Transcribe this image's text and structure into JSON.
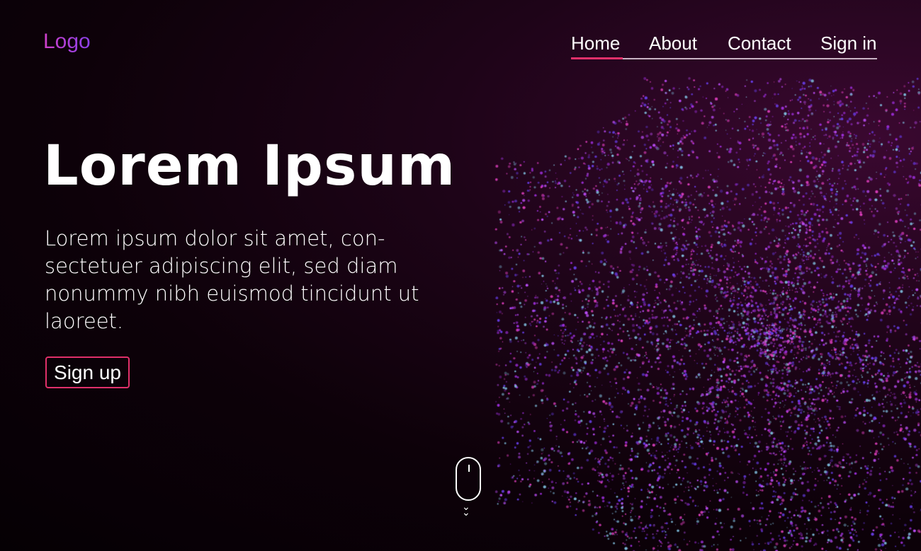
{
  "header": {
    "logo": "Logo",
    "nav": [
      {
        "label": "Home",
        "active": true
      },
      {
        "label": "About"
      },
      {
        "label": "Contact"
      },
      {
        "label": "Sign in"
      }
    ]
  },
  "hero": {
    "title": "Lorem Ipsum",
    "description": "Lorem ipsum dolor sit amet, con-sectetuer adipiscing elit, sed diam nonummy nibh euismod tincidunt ut laoreet.",
    "signup_label": "Sign up"
  },
  "scroll_indicator": {
    "icon": "mouse-icon",
    "chevron": "»"
  },
  "colors": {
    "accent": "#e0306a",
    "background": "#0d0109",
    "particles": [
      "#a030e0",
      "#e040c0",
      "#6a40f0",
      "#c050ff",
      "#80c0e0"
    ]
  }
}
